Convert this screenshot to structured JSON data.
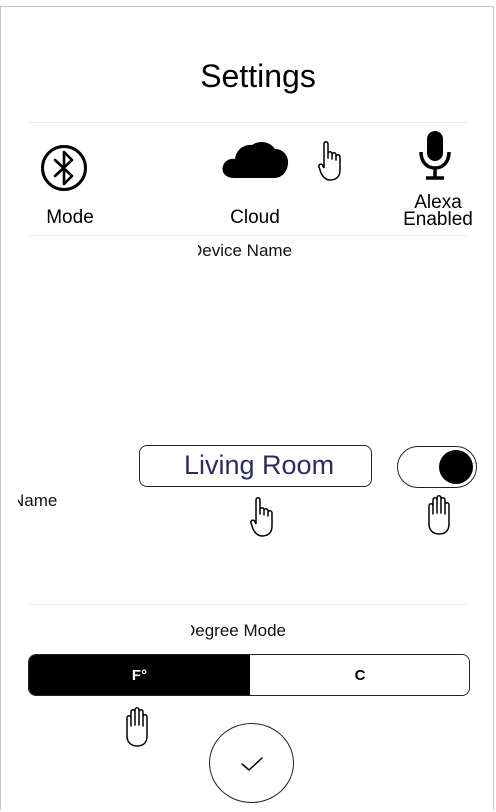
{
  "header": {
    "title": "Settings"
  },
  "connections": [
    {
      "label": "Mode",
      "icon": "bluetooth-icon"
    },
    {
      "label": "Cloud",
      "icon": "cloud-icon"
    },
    {
      "label_line1": "Alexa",
      "label_line2": "Enabled",
      "icon": "microphone-icon"
    }
  ],
  "device_name": {
    "section_title": "Device Name",
    "row_label": "Name",
    "input_value": "Living Room",
    "toggle_state": "on"
  },
  "degree_mode": {
    "section_title": "Degree Mode",
    "options": [
      "F°",
      "C°"
    ],
    "selected": "F°"
  },
  "colors": {
    "accent": "#000000",
    "border": "#222222",
    "input_text": "#2a2f5a",
    "divider": "#eeeeee"
  }
}
